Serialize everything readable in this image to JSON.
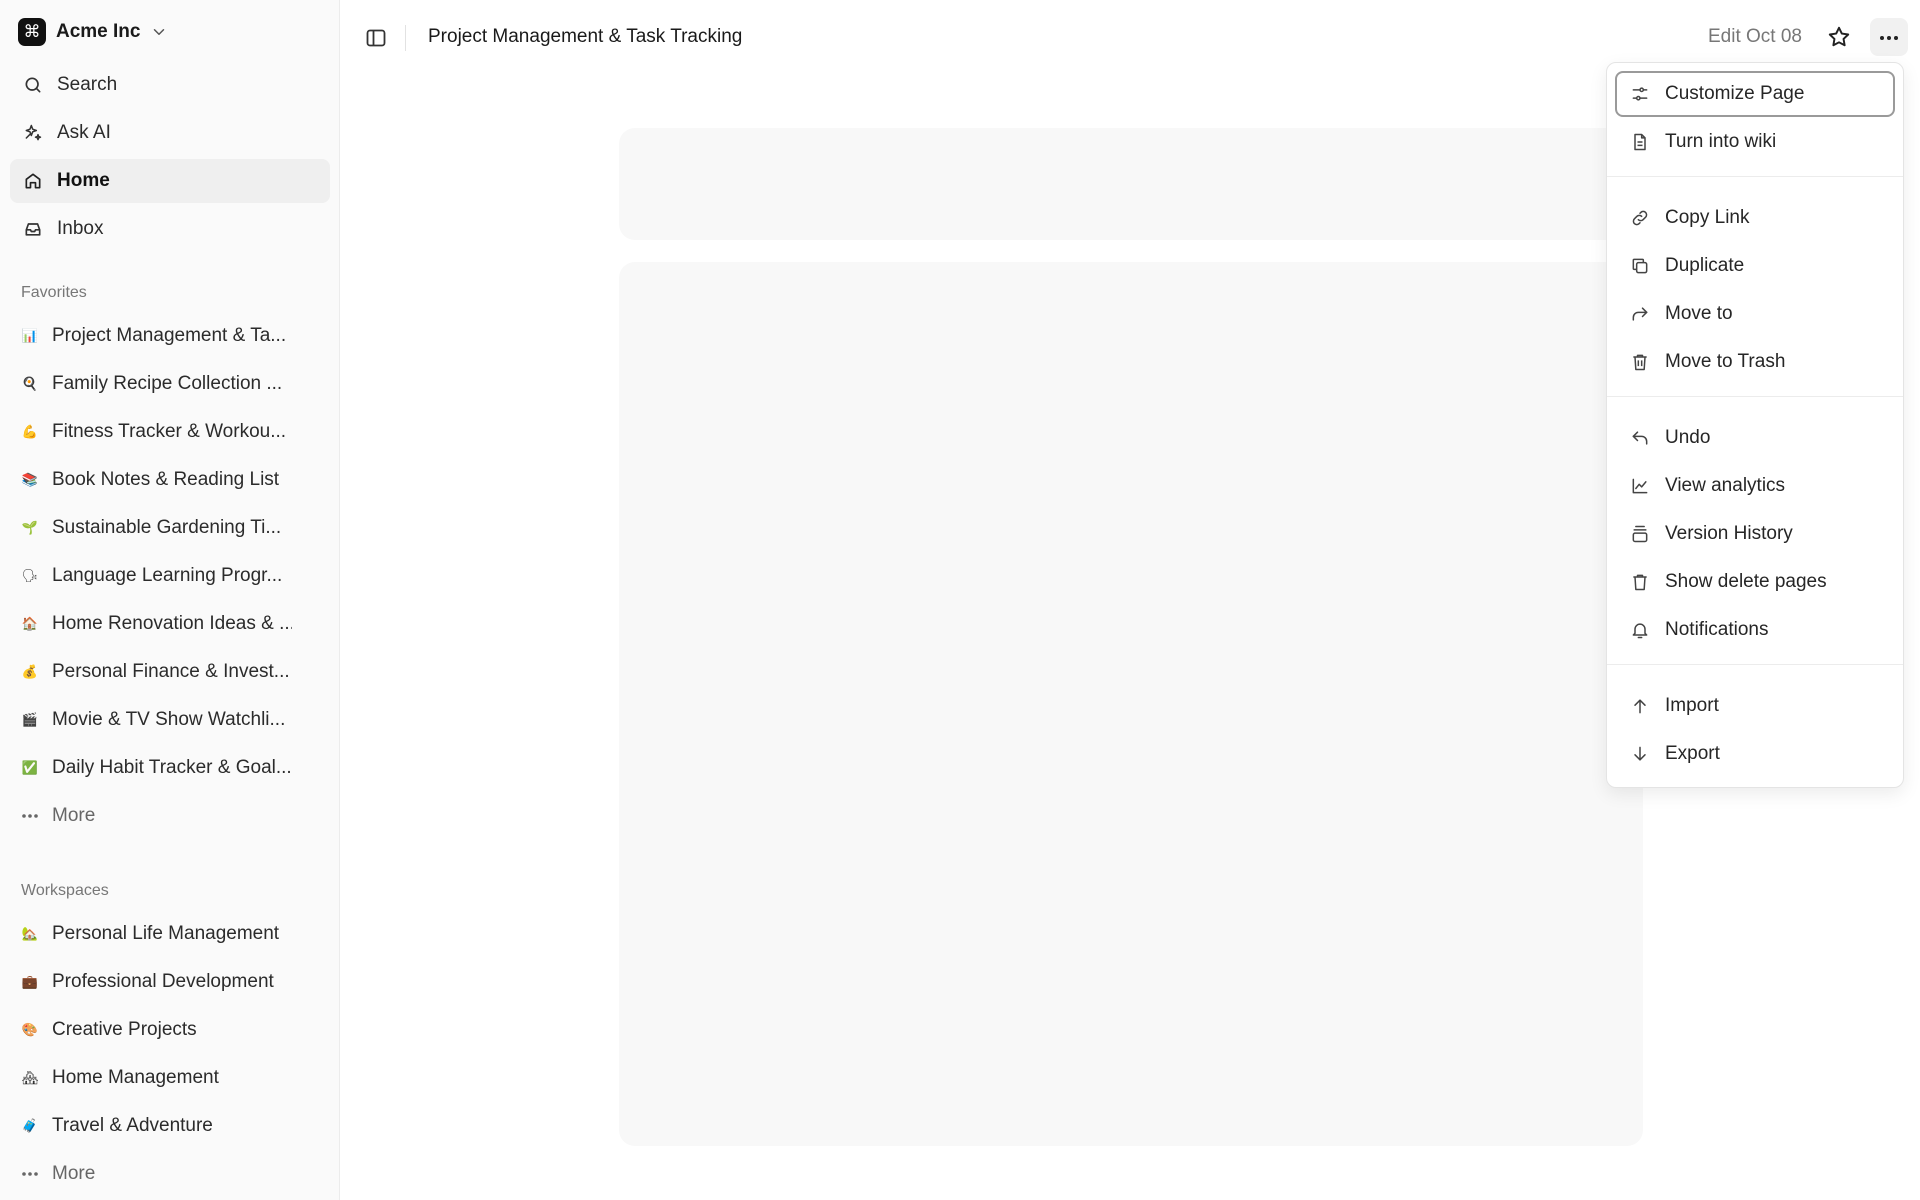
{
  "workspace": {
    "name": "Acme Inc",
    "logo_glyph": "⌘"
  },
  "nav": [
    {
      "key": "search",
      "label": "Search",
      "icon": "search-icon"
    },
    {
      "key": "ask-ai",
      "label": "Ask AI",
      "icon": "sparkles-icon"
    },
    {
      "key": "home",
      "label": "Home",
      "icon": "home-icon",
      "active": true
    },
    {
      "key": "inbox",
      "label": "Inbox",
      "icon": "inbox-icon"
    }
  ],
  "favorites": {
    "label": "Favorites",
    "items": [
      {
        "emoji": "📊",
        "label": "Project Management & Ta..."
      },
      {
        "emoji": "🍳",
        "label": "Family Recipe Collection ..."
      },
      {
        "emoji": "💪",
        "label": "Fitness Tracker & Workou..."
      },
      {
        "emoji": "📚",
        "label": "Book Notes & Reading List"
      },
      {
        "emoji": "🌱",
        "label": "Sustainable Gardening Ti..."
      },
      {
        "emoji": "🗣",
        "label": "Language Learning Progr..."
      },
      {
        "emoji": "🏠",
        "label": "Home Renovation Ideas & ..."
      },
      {
        "emoji": "💰",
        "label": "Personal Finance & Invest..."
      },
      {
        "emoji": "🎬",
        "label": "Movie & TV Show Watchli..."
      },
      {
        "emoji": "✅",
        "label": "Daily Habit Tracker & Goal..."
      }
    ],
    "more_label": "More"
  },
  "workspaces": {
    "label": "Workspaces",
    "items": [
      {
        "emoji": "🏡",
        "label": "Personal Life Management"
      },
      {
        "emoji": "💼",
        "label": "Professional Development"
      },
      {
        "emoji": "🎨",
        "label": "Creative Projects"
      },
      {
        "emoji": "🏘",
        "label": "Home Management"
      },
      {
        "emoji": "🧳",
        "label": "Travel & Adventure"
      }
    ],
    "more_label": "More"
  },
  "header": {
    "page_title": "Project Management & Task Tracking",
    "edit_date": "Edit Oct 08"
  },
  "menu": {
    "groups": [
      [
        {
          "label": "Customize Page",
          "icon": "sliders-icon",
          "focused": true
        },
        {
          "label": "Turn into wiki",
          "icon": "document-icon"
        }
      ],
      [
        {
          "label": "Copy Link",
          "icon": "link-icon"
        },
        {
          "label": "Duplicate",
          "icon": "copy-icon"
        },
        {
          "label": "Move to",
          "icon": "forward-arrow-icon"
        },
        {
          "label": "Move to Trash",
          "icon": "trash-icon"
        }
      ],
      [
        {
          "label": "Undo",
          "icon": "undo-icon"
        },
        {
          "label": "View analytics",
          "icon": "line-chart-icon"
        },
        {
          "label": "Version History",
          "icon": "layers-icon"
        },
        {
          "label": "Show delete pages",
          "icon": "trash-icon"
        },
        {
          "label": "Notifications",
          "icon": "bell-icon"
        }
      ],
      [
        {
          "label": "Import",
          "icon": "arrow-up-icon"
        },
        {
          "label": "Export",
          "icon": "arrow-down-icon"
        }
      ]
    ]
  },
  "colors": {
    "sidebar_bg": "#fafafa",
    "active_item_bg": "#efefef",
    "placeholder_bg": "#f8f8f8",
    "menu_focus_border": "#9a9a9a"
  }
}
